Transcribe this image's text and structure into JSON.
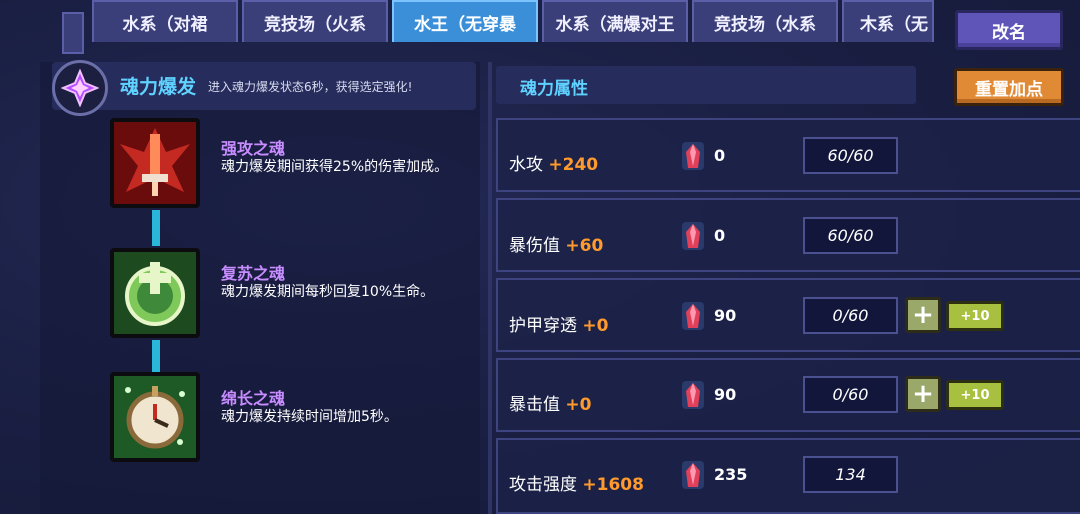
{
  "tabs": [
    {
      "label": "水系（对裙",
      "active": false
    },
    {
      "label": "竞技场（火系",
      "active": false
    },
    {
      "label": "水王（无穿暴",
      "active": true
    },
    {
      "label": "水系（满爆对王",
      "active": false
    },
    {
      "label": "竞技场（水系",
      "active": false
    },
    {
      "label": "木系（无",
      "active": false
    }
  ],
  "rename_button": "改名",
  "burst": {
    "title": "魂力爆发",
    "description": "进入魂力爆发状态6秒，获得选定强化!"
  },
  "skills": [
    {
      "name": "强攻之魂",
      "description": "魂力爆发期间获得25%的伤害加成。",
      "icon": "red-sword-soul-icon"
    },
    {
      "name": "复苏之魂",
      "description": "魂力爆发期间每秒回复10%生命。",
      "icon": "green-heal-soul-icon"
    },
    {
      "name": "绵长之魂",
      "description": "魂力爆发持续时间增加5秒。",
      "icon": "clock-soul-icon"
    }
  ],
  "attributes_title": "魂力属性",
  "reset_button": "重置加点",
  "attributes": [
    {
      "label": "水攻",
      "bonus": "+240",
      "cost": "0",
      "value": "60/60",
      "upgradable": false
    },
    {
      "label": "暴伤值",
      "bonus": "+60",
      "cost": "0",
      "value": "60/60",
      "upgradable": false
    },
    {
      "label": "护甲穿透",
      "bonus": "+0",
      "cost": "90",
      "value": "0/60",
      "upgradable": true,
      "plus_label": "+",
      "plus10_label": "+10"
    },
    {
      "label": "暴击值",
      "bonus": "+0",
      "cost": "90",
      "value": "0/60",
      "upgradable": true,
      "plus_label": "+",
      "plus10_label": "+10"
    },
    {
      "label": "攻击强度",
      "bonus": "+1608",
      "cost": "235",
      "value": "134",
      "upgradable": false
    }
  ],
  "colors": {
    "accent_cyan": "#5fd2ff",
    "bonus_orange": "#ff9a2e",
    "skill_purple": "#c78cff",
    "tab_active": "#3b8fd8",
    "reset_orange": "#e08a35"
  }
}
